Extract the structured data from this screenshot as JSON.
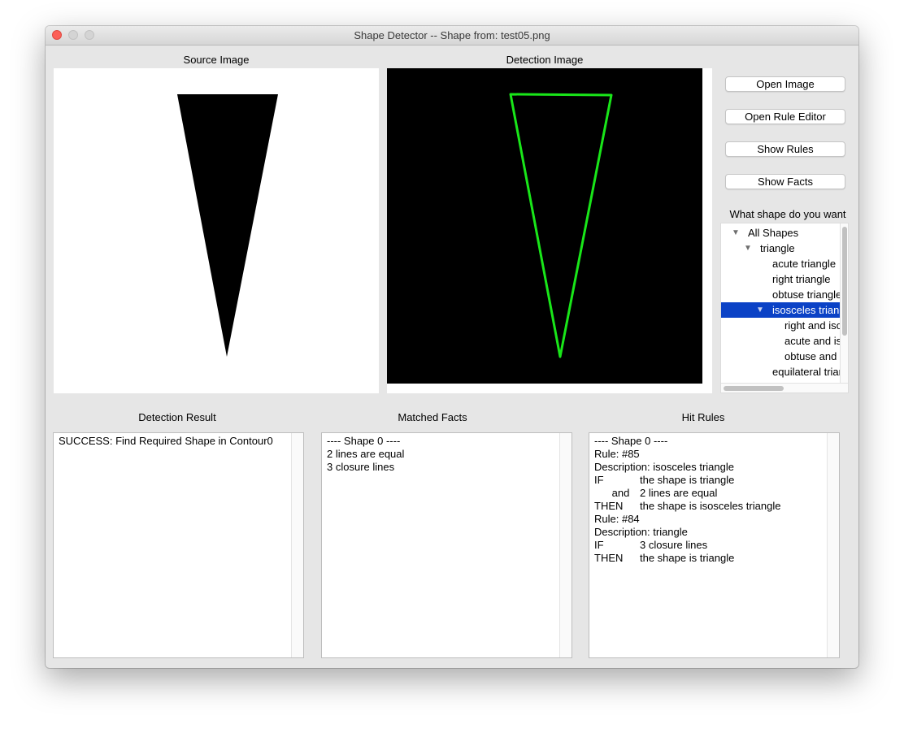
{
  "window": {
    "title": "Shape Detector -- Shape from: test05.png"
  },
  "labels": {
    "source_image": "Source Image",
    "detection_image": "Detection Image",
    "shape_question": "What shape do you want",
    "detection_result": "Detection Result",
    "matched_facts": "Matched Facts",
    "hit_rules": "Hit Rules"
  },
  "buttons": {
    "open_image": "Open Image",
    "open_rule_editor": "Open Rule Editor",
    "show_rules": "Show Rules",
    "show_facts": "Show Facts"
  },
  "tree": {
    "items": [
      {
        "label": "All Shapes",
        "level": 0,
        "expanded": true
      },
      {
        "label": "triangle",
        "level": 1,
        "expanded": true
      },
      {
        "label": "acute triangle",
        "level": 2
      },
      {
        "label": "right triangle",
        "level": 2
      },
      {
        "label": "obtuse triangle",
        "level": 2
      },
      {
        "label": "isosceles triangle",
        "level": 2,
        "expanded": true,
        "selected": true
      },
      {
        "label": "right and isosceles triangle",
        "level": 3
      },
      {
        "label": "acute and isosceles triangle",
        "level": 3
      },
      {
        "label": "obtuse and isosceles triangle",
        "level": 3
      },
      {
        "label": "equilateral triangle",
        "level": 2
      }
    ],
    "selection_color": "#0b42c6"
  },
  "detection_result": {
    "lines": [
      "SUCCESS: Find Required Shape in Contour0"
    ]
  },
  "matched_facts": {
    "lines": [
      "---- Shape 0 ----",
      "2 lines are equal",
      "3 closure lines"
    ]
  },
  "hit_rules": {
    "lines": [
      {
        "a": "---- Shape 0 ----",
        "b": ""
      },
      {
        "a": "Rule: #85",
        "b": ""
      },
      {
        "a": "Description: isosceles triangle",
        "b": ""
      },
      {
        "a": "IF",
        "b": "the shape is triangle"
      },
      {
        "a": "      and",
        "b": "2 lines are equal"
      },
      {
        "a": "THEN",
        "b": "the shape is isosceles triangle"
      },
      {
        "a": "Rule: #84",
        "b": ""
      },
      {
        "a": "Description: triangle",
        "b": ""
      },
      {
        "a": "IF",
        "b": "3 closure lines"
      },
      {
        "a": "THEN",
        "b": "the shape is triangle"
      }
    ]
  },
  "colors": {
    "contour": "#19e619",
    "shape_fill": "#000000"
  }
}
